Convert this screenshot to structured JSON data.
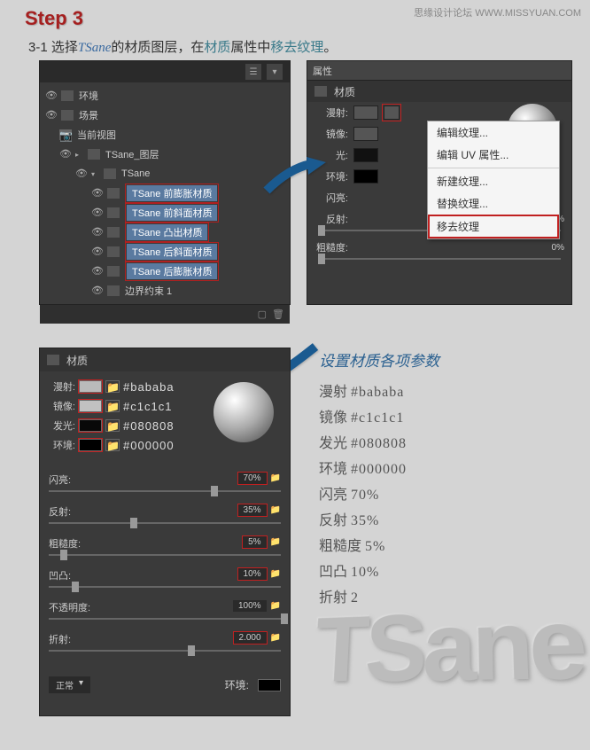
{
  "watermark": "思缘设计论坛 WWW.MISSYUAN.COM",
  "step_title": "Step 3",
  "instruction": {
    "prefix": "3-1 选择",
    "tsane": "TSane",
    "mid": "的材质图层，在",
    "mat": "材质",
    "mid2": "属性中",
    "remove": "移去纹理",
    "end": "。"
  },
  "layers": {
    "env": "环境",
    "scene": "场景",
    "current_view": "当前视图",
    "tsane_layer": "TSane_图层",
    "tsane": "TSane",
    "materials": [
      "TSane 前膨胀材质",
      "TSane 前斜面材质",
      "TSane 凸出材质",
      "TSane 后斜面材质",
      "TSane 后膨胀材质"
    ],
    "boundary": "边界约束 1"
  },
  "props1": {
    "tab": "属性",
    "title": "材质",
    "diffuse": "漫射:",
    "specular": "镜像:",
    "illum": "光:",
    "ambient": "环境:",
    "shine": "闪亮:",
    "reflect": "反射:",
    "rough": "粗糙度:",
    "pct0": "0%"
  },
  "context_menu": {
    "edit_texture": "编辑纹理...",
    "edit_uv": "编辑 UV 属性...",
    "new_texture": "新建纹理...",
    "replace_texture": "替换纹理...",
    "remove_texture": "移去纹理"
  },
  "props2": {
    "title": "材质",
    "rows": [
      {
        "label": "漫射:",
        "hex": "#bababa",
        "color": "#bababa"
      },
      {
        "label": "镜像:",
        "hex": "#c1c1c1",
        "color": "#c1c1c1"
      },
      {
        "label": "发光:",
        "hex": "#080808",
        "color": "#080808"
      },
      {
        "label": "环境:",
        "hex": "#000000",
        "color": "#000000"
      }
    ],
    "sliders": [
      {
        "label": "闪亮:",
        "val": "70%",
        "red": true,
        "pos": 70
      },
      {
        "label": "反射:",
        "val": "35%",
        "red": true,
        "pos": 35
      },
      {
        "label": "粗糙度:",
        "val": "5%",
        "red": true,
        "pos": 5
      },
      {
        "label": "凹凸:",
        "val": "10%",
        "red": true,
        "pos": 10
      },
      {
        "label": "不透明度:",
        "val": "100%",
        "red": false,
        "pos": 100
      },
      {
        "label": "折射:",
        "val": "2.000",
        "red": true,
        "pos": 60
      }
    ],
    "normal": "正常",
    "env": "环境:"
  },
  "settings": {
    "title": "设置材质各项参数",
    "lines": [
      "漫射 #bababa",
      "镜像 #c1c1c1",
      "发光 #080808",
      "环境 #000000",
      "闪亮 70%",
      "反射 35%",
      "粗糙度 5%",
      "凹凸 10%",
      "折射 2"
    ]
  },
  "bg3d": "TSane"
}
